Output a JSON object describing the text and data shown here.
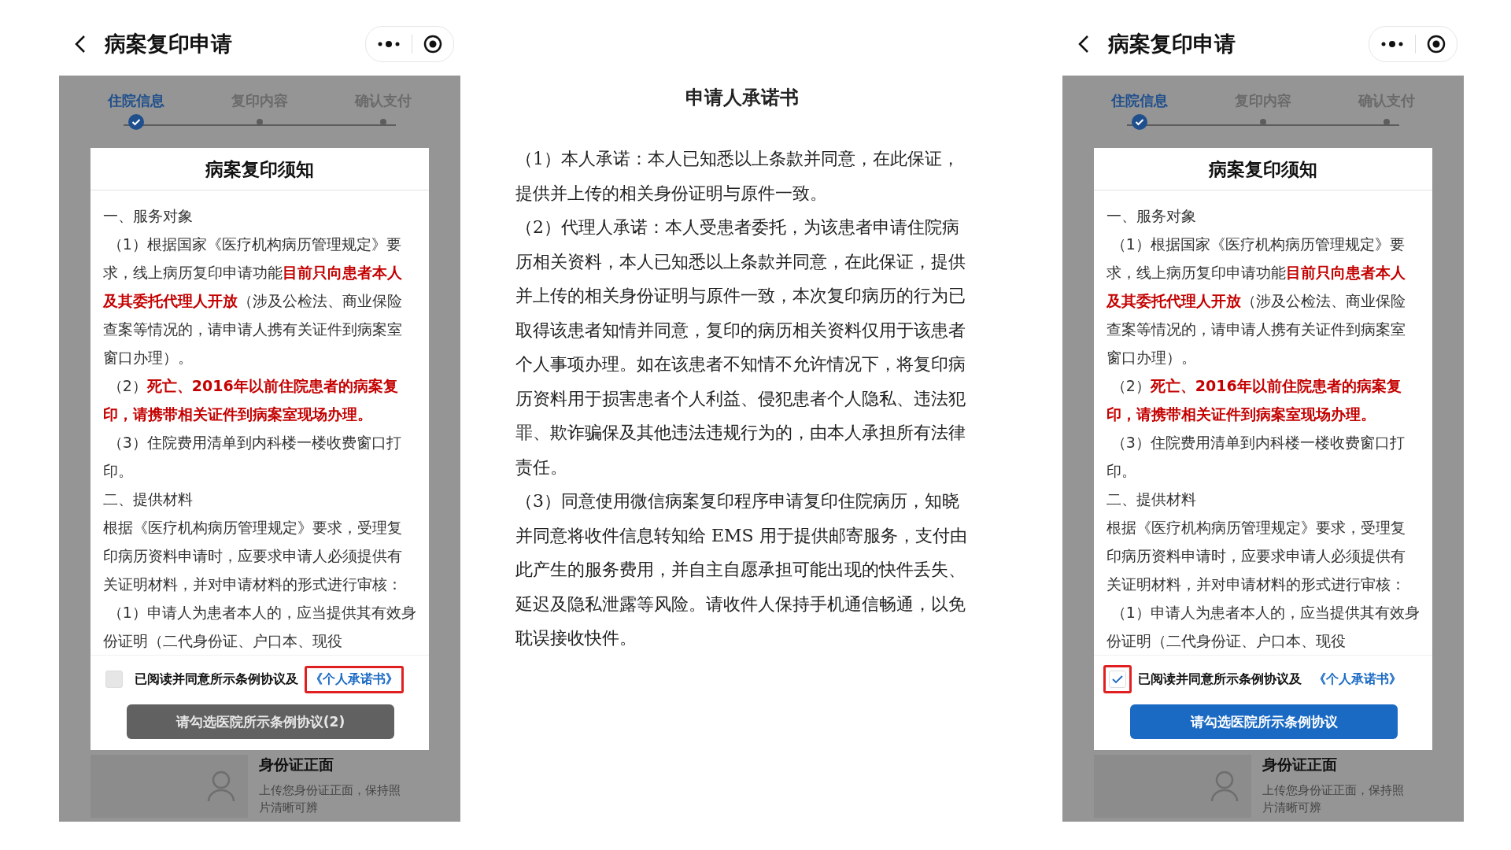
{
  "phones": [
    {
      "title": "病案复印申请",
      "steps": [
        {
          "label": "住院信息",
          "selected": true
        },
        {
          "label": "复印内容",
          "selected": false
        },
        {
          "label": "确认支付",
          "selected": false
        }
      ],
      "modal": {
        "title": "病案复印须知",
        "paragraphs": [
          {
            "kind": "heading",
            "text": "一、服务对象"
          },
          {
            "kind": "item",
            "text": "（1）根据国家《医疗机构病历管理规定》要求，线上病历复印申请功能**目前只向患者本人及其委托代理人开放**（涉及公检法、商业保险查案等情况的，请申请人携有关证件到病案室窗口办理）。"
          },
          {
            "kind": "item",
            "text": "（2）**死亡、2016年以前住院患者的病案复印，请携带相关证件到病案室现场办理。**"
          },
          {
            "kind": "item",
            "text": "（3）住院费用清单到内科楼一楼收费窗口打印。"
          },
          {
            "kind": "heading",
            "text": "二、提供材料"
          },
          {
            "kind": "body",
            "text": "根据《医疗机构病历管理规定》要求，受理复印病历资料申请时，应要求申请人必须提供有关证明材料，并对申请材料的形式进行审核："
          },
          {
            "kind": "item",
            "text": "（1）申请人为患者本人的，应当提供其有效身份证明（二代身份证、户口本、现役"
          }
        ],
        "agreement": {
          "checked": false,
          "text": "已阅读并同意所示条例协议及",
          "link": "《个人承诺书》",
          "checkbox_highlighted": false,
          "link_highlighted": true
        },
        "button": {
          "label": "请勾选医院所示条例协议(2)",
          "disabled": true
        }
      },
      "id_card": {
        "title": "身份证正面",
        "hint": "上传您身份证正面，保持照片清晰可辨"
      }
    },
    {
      "title": "病案复印申请",
      "steps": [
        {
          "label": "住院信息",
          "selected": true
        },
        {
          "label": "复印内容",
          "selected": false
        },
        {
          "label": "确认支付",
          "selected": false
        }
      ],
      "modal": {
        "title": "病案复印须知",
        "paragraphs": [
          {
            "kind": "heading",
            "text": "一、服务对象"
          },
          {
            "kind": "item",
            "text": "（1）根据国家《医疗机构病历管理规定》要求，线上病历复印申请功能**目前只向患者本人及其委托代理人开放**（涉及公检法、商业保险查案等情况的，请申请人携有关证件到病案室窗口办理）。"
          },
          {
            "kind": "item",
            "text": "（2）**死亡、2016年以前住院患者的病案复印，请携带相关证件到病案室现场办理。**"
          },
          {
            "kind": "item",
            "text": "（3）住院费用清单到内科楼一楼收费窗口打印。"
          },
          {
            "kind": "heading",
            "text": "二、提供材料"
          },
          {
            "kind": "body",
            "text": "根据《医疗机构病历管理规定》要求，受理复印病历资料申请时，应要求申请人必须提供有关证明材料，并对申请材料的形式进行审核："
          },
          {
            "kind": "item",
            "text": "（1）申请人为患者本人的，应当提供其有效身份证明（二代身份证、户口本、现役"
          }
        ],
        "agreement": {
          "checked": true,
          "text": "已阅读并同意所示条例协议及",
          "link": "《个人承诺书》",
          "checkbox_highlighted": true,
          "link_highlighted": false
        },
        "button": {
          "label": "请勾选医院所示条例协议",
          "disabled": false
        }
      },
      "id_card": {
        "title": "身份证正面",
        "hint": "上传您身份证正面，保持照片清晰可辨"
      }
    }
  ],
  "document": {
    "title": "申请人承诺书",
    "paragraphs": [
      "（1）本人承诺：本人已知悉以上条款并同意，在此保证，提供并上传的相关身份证明与原件一致。",
      "（2）代理人承诺：本人受患者委托，为该患者申请住院病历相关资料，本人已知悉以上条款并同意，在此保证，提供并上传的相关身份证明与原件一致，本次复印病历的行为已取得该患者知情并同意，复印的病历相关资料仅用于该患者个人事项办理。如在该患者不知情不允许情况下，将复印病历资料用于损害患者个人利益、侵犯患者个人隐私、违法犯罪、欺诈骗保及其他违法违规行为的，由本人承担所有法律责任。",
      "（3）同意使用微信病案复印程序申请复印住院病历，知晓并同意将收件信息转知给 EMS 用于提供邮寄服务，支付由此产生的服务费用，并自主自愿承担可能出现的快件丢失、延迟及隐私泄露等风险。请收件人保持手机通信畅通，以免耽误接收快件。"
    ]
  }
}
